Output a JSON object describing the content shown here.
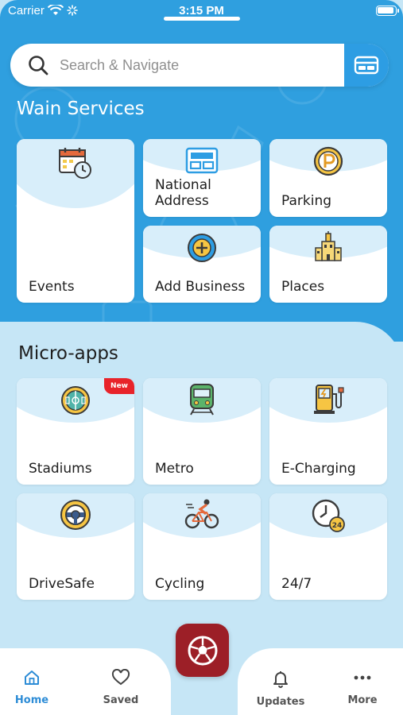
{
  "status_bar": {
    "carrier": "Carrier",
    "time": "3:15 PM"
  },
  "search": {
    "placeholder": "Search & Navigate",
    "card_icon": "card-icon"
  },
  "wain_services": {
    "title": "Wain Services",
    "items": [
      {
        "label": "Events",
        "icon": "calendar-clock-icon"
      },
      {
        "label": "National\nAddress",
        "icon": "address-card-icon"
      },
      {
        "label": "Parking",
        "icon": "parking-icon"
      },
      {
        "label": "Add Business",
        "icon": "add-circle-icon"
      },
      {
        "label": "Places",
        "icon": "building-icon"
      }
    ]
  },
  "micro_apps": {
    "title": "Micro-apps",
    "items": [
      {
        "label": "Stadiums",
        "icon": "stadium-icon",
        "badge": "New"
      },
      {
        "label": "Metro",
        "icon": "train-icon"
      },
      {
        "label": "E-Charging",
        "icon": "charging-station-icon"
      },
      {
        "label": "DriveSafe",
        "icon": "steering-wheel-icon"
      },
      {
        "label": "Cycling",
        "icon": "cyclist-icon"
      },
      {
        "label": "24/7",
        "icon": "clock-24-icon"
      }
    ]
  },
  "tab_bar": {
    "items": [
      {
        "label": "Home",
        "icon": "home-icon",
        "active": true
      },
      {
        "label": "Saved",
        "icon": "heart-icon"
      },
      {
        "label": "Updates",
        "icon": "bell-icon"
      },
      {
        "label": "More",
        "icon": "more-dots-icon"
      }
    ],
    "center_button_icon": "soccer-ball-icon"
  },
  "colors": {
    "primary_blue": "#2f9fdf",
    "light_blue": "#c6e6f6",
    "accent_red": "#9c1f27",
    "badge_red": "#e8232a",
    "active_tab": "#2d8cd6"
  }
}
